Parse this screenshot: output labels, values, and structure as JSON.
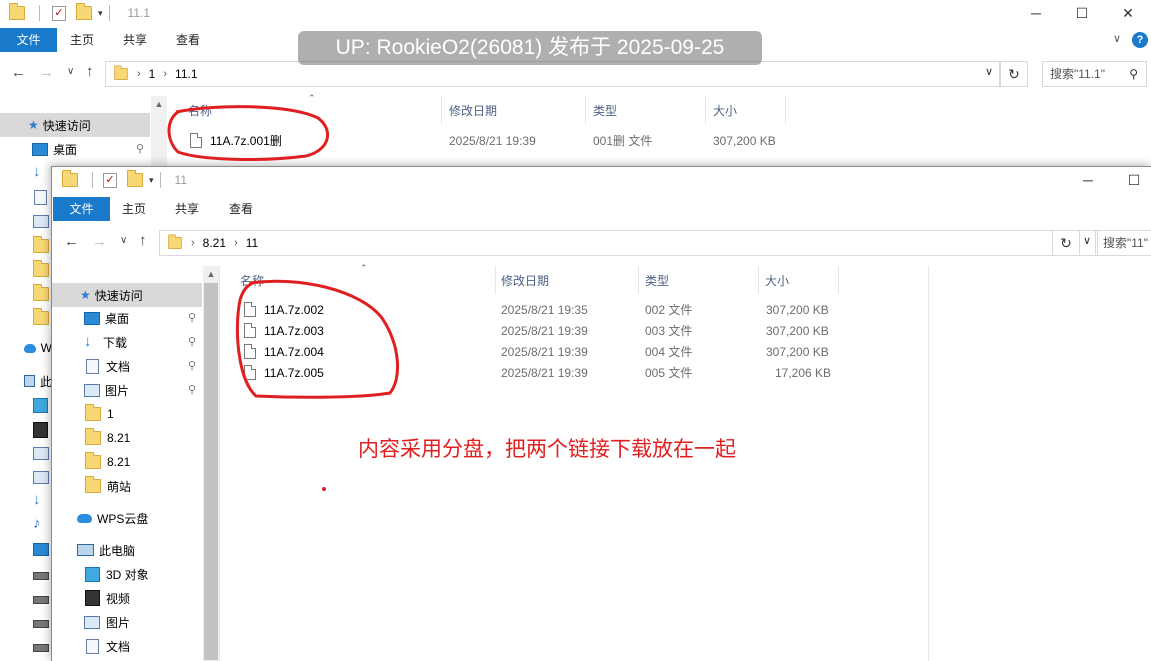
{
  "win1": {
    "title": "11.1",
    "tabs": [
      "文件",
      "主页",
      "共享",
      "查看"
    ],
    "path": [
      "1",
      "11.1"
    ],
    "search_placeholder": "搜索\"11.1\"",
    "columns": [
      "名称",
      "修改日期",
      "类型",
      "大小"
    ],
    "files": [
      {
        "name": "11A.7z.001删",
        "date": "2025/8/21 19:39",
        "type": "001删 文件",
        "size": "307,200 KB"
      }
    ],
    "quick_access": "快速访问",
    "sidebar": [
      {
        "label": "桌面"
      }
    ],
    "partial_labels": {
      "wps": "W",
      "pc": "此"
    }
  },
  "win2": {
    "title": "11",
    "tabs": [
      "文件",
      "主页",
      "共享",
      "查看"
    ],
    "path": [
      "8.21",
      "11"
    ],
    "search_placeholder": "搜索\"11\"",
    "columns": [
      "名称",
      "修改日期",
      "类型",
      "大小"
    ],
    "files": [
      {
        "name": "11A.7z.002",
        "date": "2025/8/21 19:35",
        "type": "002 文件",
        "size": "307,200 KB"
      },
      {
        "name": "11A.7z.003",
        "date": "2025/8/21 19:39",
        "type": "003 文件",
        "size": "307,200 KB"
      },
      {
        "name": "11A.7z.004",
        "date": "2025/8/21 19:39",
        "type": "004 文件",
        "size": "307,200 KB"
      },
      {
        "name": "11A.7z.005",
        "date": "2025/8/21 19:39",
        "type": "005 文件",
        "size": "17,206 KB"
      }
    ],
    "quick_access": "快速访问",
    "sidebar": {
      "desktop": "桌面",
      "downloads": "下载",
      "documents": "文档",
      "pictures": "图片",
      "f1": "1",
      "f2": "8.21",
      "f3": "8.21",
      "f4": "萌站",
      "wps": "WPS云盘",
      "pc": "此电脑",
      "obj3d": "3D 对象",
      "video": "视频",
      "pictures2": "图片",
      "documents2": "文档"
    }
  },
  "overlay": {
    "watermark": "UP: RookieO2(26081) 发布于 2025-09-25",
    "note": "内容采用分盘，把两个链接下载放在一起",
    "color": "#e02020"
  }
}
